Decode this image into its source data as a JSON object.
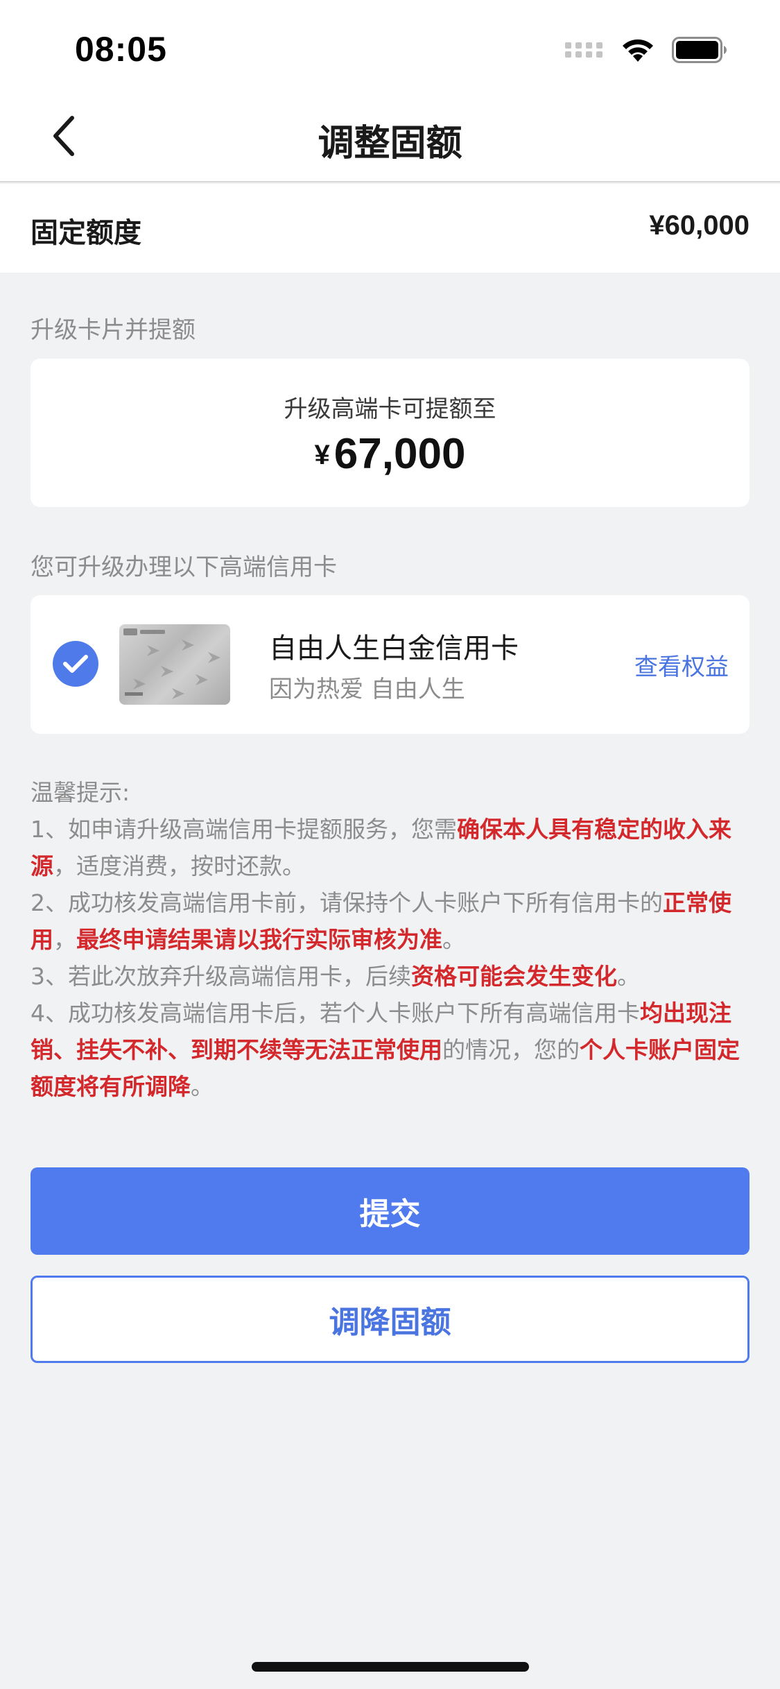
{
  "status_bar": {
    "time": "08:05"
  },
  "nav": {
    "title": "调整固额"
  },
  "quota": {
    "label": "固定额度",
    "value": "¥60,000"
  },
  "upgrade_section": {
    "title": "升级卡片并提额",
    "caption": "升级高端卡可提额至",
    "currency": "¥",
    "amount": "67,000"
  },
  "cards_section": {
    "title": "您可升级办理以下高端信用卡",
    "card": {
      "name": "自由人生白金信用卡",
      "slogan": "因为热爱 自由人生",
      "link": "查看权益",
      "selected": true
    }
  },
  "tips": {
    "heading": "温馨提示:",
    "p1": [
      "1、如申请升级高端信用卡提额服务，您需",
      "确保本人具有稳定的收入来源",
      "，适度消费，按时还款。"
    ],
    "p2": [
      "2、成功核发高端信用卡前，请保持个人卡账户下所有信用卡的",
      "正常使用",
      "，",
      "最终申请结果请以我行实际审核为准",
      "。"
    ],
    "p3": [
      "3、若此次放弃升级高端信用卡，后续",
      "资格可能会发生变化",
      "。"
    ],
    "p4": [
      "4、成功核发高端信用卡后，若个人卡账户下所有高端信用卡",
      "均出现注销、挂失不补、到期不续等无法正常使用",
      "的情况，您的",
      "个人卡账户固定额度将有所调降",
      "。"
    ]
  },
  "buttons": {
    "submit": "提交",
    "reduce": "调降固额"
  },
  "colors": {
    "accent": "#4f7bee",
    "highlight": "#d3282c"
  },
  "icons": [
    "signal-icon",
    "wifi-icon",
    "battery-icon",
    "back-icon",
    "check-icon"
  ]
}
